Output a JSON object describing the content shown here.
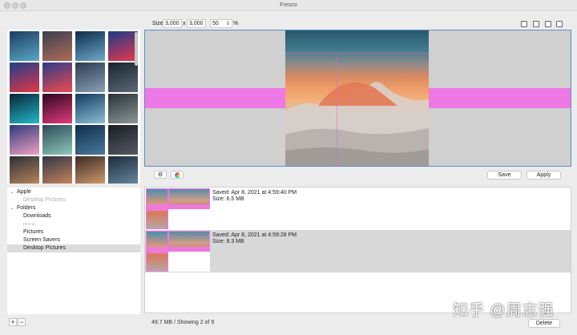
{
  "window": {
    "title": "Fresco"
  },
  "thumbnails": [
    {
      "c1": "#1b3d5e",
      "c2": "#5aa7c9"
    },
    {
      "c1": "#3a3f52",
      "c2": "#b06c55"
    },
    {
      "c1": "#0c2c4a",
      "c2": "#6fa8c8"
    },
    {
      "c1": "#1a3a8a",
      "c2": "#e83a4a"
    },
    {
      "c1": "#1e3f8c",
      "c2": "#e23642"
    },
    {
      "c1": "#2a3c8a",
      "c2": "#ef4a4c"
    },
    {
      "c1": "#2c3a52",
      "c2": "#8aa0b4"
    },
    {
      "c1": "#1a2330",
      "c2": "#5a6a76"
    },
    {
      "c1": "#08243a",
      "c2": "#25b8c8"
    },
    {
      "c1": "#2a0620",
      "c2": "#e23c7a"
    },
    {
      "c1": "#143a5c",
      "c2": "#8ac0d8"
    },
    {
      "c1": "#2a3236",
      "c2": "#8a9698"
    },
    {
      "c1": "#2c3a7c",
      "c2": "#f0a0c0"
    },
    {
      "c1": "#2a4a5a",
      "c2": "#8ec8b8"
    },
    {
      "c1": "#0e2c4a",
      "c2": "#4a7a9c"
    },
    {
      "c1": "#1a1c22",
      "c2": "#555a62"
    },
    {
      "c1": "#2a2e36",
      "c2": "#c08a5c"
    },
    {
      "c1": "#2e3648",
      "c2": "#d0885c"
    },
    {
      "c1": "#3a2a24",
      "c2": "#d8a070"
    },
    {
      "c1": "#1c2a3a",
      "c2": "#6c8ca4"
    }
  ],
  "toolbar": {
    "size_label": "Size",
    "width_value": "3,000",
    "times_label": "x",
    "height_value": "3,000",
    "zoom_value": "50",
    "percent_label": "%"
  },
  "controls": {
    "gear_icon": "⚙",
    "save_label": "Save",
    "apply_label": "Apply"
  },
  "sources": [
    {
      "label": "Apple",
      "kind": "group",
      "expanded": true
    },
    {
      "label": "Desktop Pictures",
      "kind": "item",
      "disabled": true
    },
    {
      "label": "Folders",
      "kind": "group",
      "expanded": true
    },
    {
      "label": "Downloads",
      "kind": "item"
    },
    {
      "label": "pics-uc",
      "kind": "item",
      "disabled": true
    },
    {
      "label": "Pictures",
      "kind": "item"
    },
    {
      "label": "Screen Savers",
      "kind": "item"
    },
    {
      "label": "Desktop Pictures",
      "kind": "item",
      "selected": true
    }
  ],
  "history": [
    {
      "saved": "Saved: Apr 8, 2021 at 4:59:40 PM",
      "size": "Size: 6.5 MB",
      "selected": false
    },
    {
      "saved": "Saved: Apr 8, 2021 at 4:59:28 PM",
      "size": "Size: 8.3 MB",
      "selected": true
    }
  ],
  "bottom": {
    "add_label": "+",
    "remove_label": "−",
    "status": "49.7 MB / Showing 2 of 9",
    "delete_label": "Delete"
  },
  "watermark": "知乎 @周志强",
  "colors": {
    "accent_pink": "#ee78e6",
    "selection_border": "#5b8ec9"
  }
}
